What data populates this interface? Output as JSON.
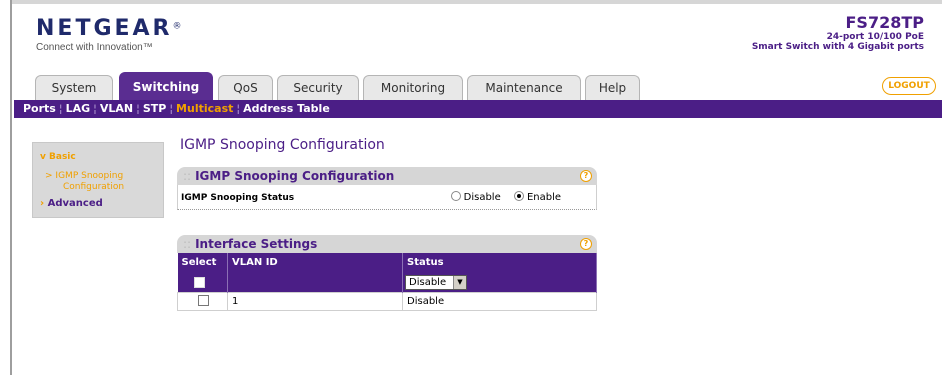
{
  "header": {
    "logo_text": "NETGEAR",
    "logo_tm": "®",
    "tagline": "Connect with Innovation™",
    "model_name": "FS728TP",
    "model_desc_1": "24-port 10/100 PoE",
    "model_desc_2": "Smart Switch with 4 Gigabit ports"
  },
  "tabs": [
    {
      "label": "System"
    },
    {
      "label": "Switching"
    },
    {
      "label": "QoS"
    },
    {
      "label": "Security"
    },
    {
      "label": "Monitoring"
    },
    {
      "label": "Maintenance"
    },
    {
      "label": "Help"
    }
  ],
  "active_tab": "Switching",
  "logout_label": "LOGOUT",
  "subnav": [
    "Ports",
    "LAG",
    "VLAN",
    "STP",
    "Multicast",
    "Address Table"
  ],
  "subnav_active": "Multicast",
  "sidebar": {
    "basic": "Basic",
    "sub_item_line1": "IGMP Snooping",
    "sub_item_line2": "Configuration",
    "advanced": "Advanced"
  },
  "page_title": "IGMP Snooping Configuration",
  "config_panel": {
    "title": "IGMP Snooping Configuration",
    "status_label": "IGMP Snooping Status",
    "options": [
      "Disable",
      "Enable"
    ],
    "selected": "Enable"
  },
  "interface_panel": {
    "title": "Interface Settings",
    "columns": [
      "Select",
      "VLAN ID",
      "Status"
    ],
    "edit_row_status": "Disable",
    "rows": [
      {
        "vlan_id": "1",
        "status": "Disable"
      }
    ]
  },
  "colors": {
    "brand_purple": "#4b1e86",
    "accent_orange": "#f0a000"
  }
}
